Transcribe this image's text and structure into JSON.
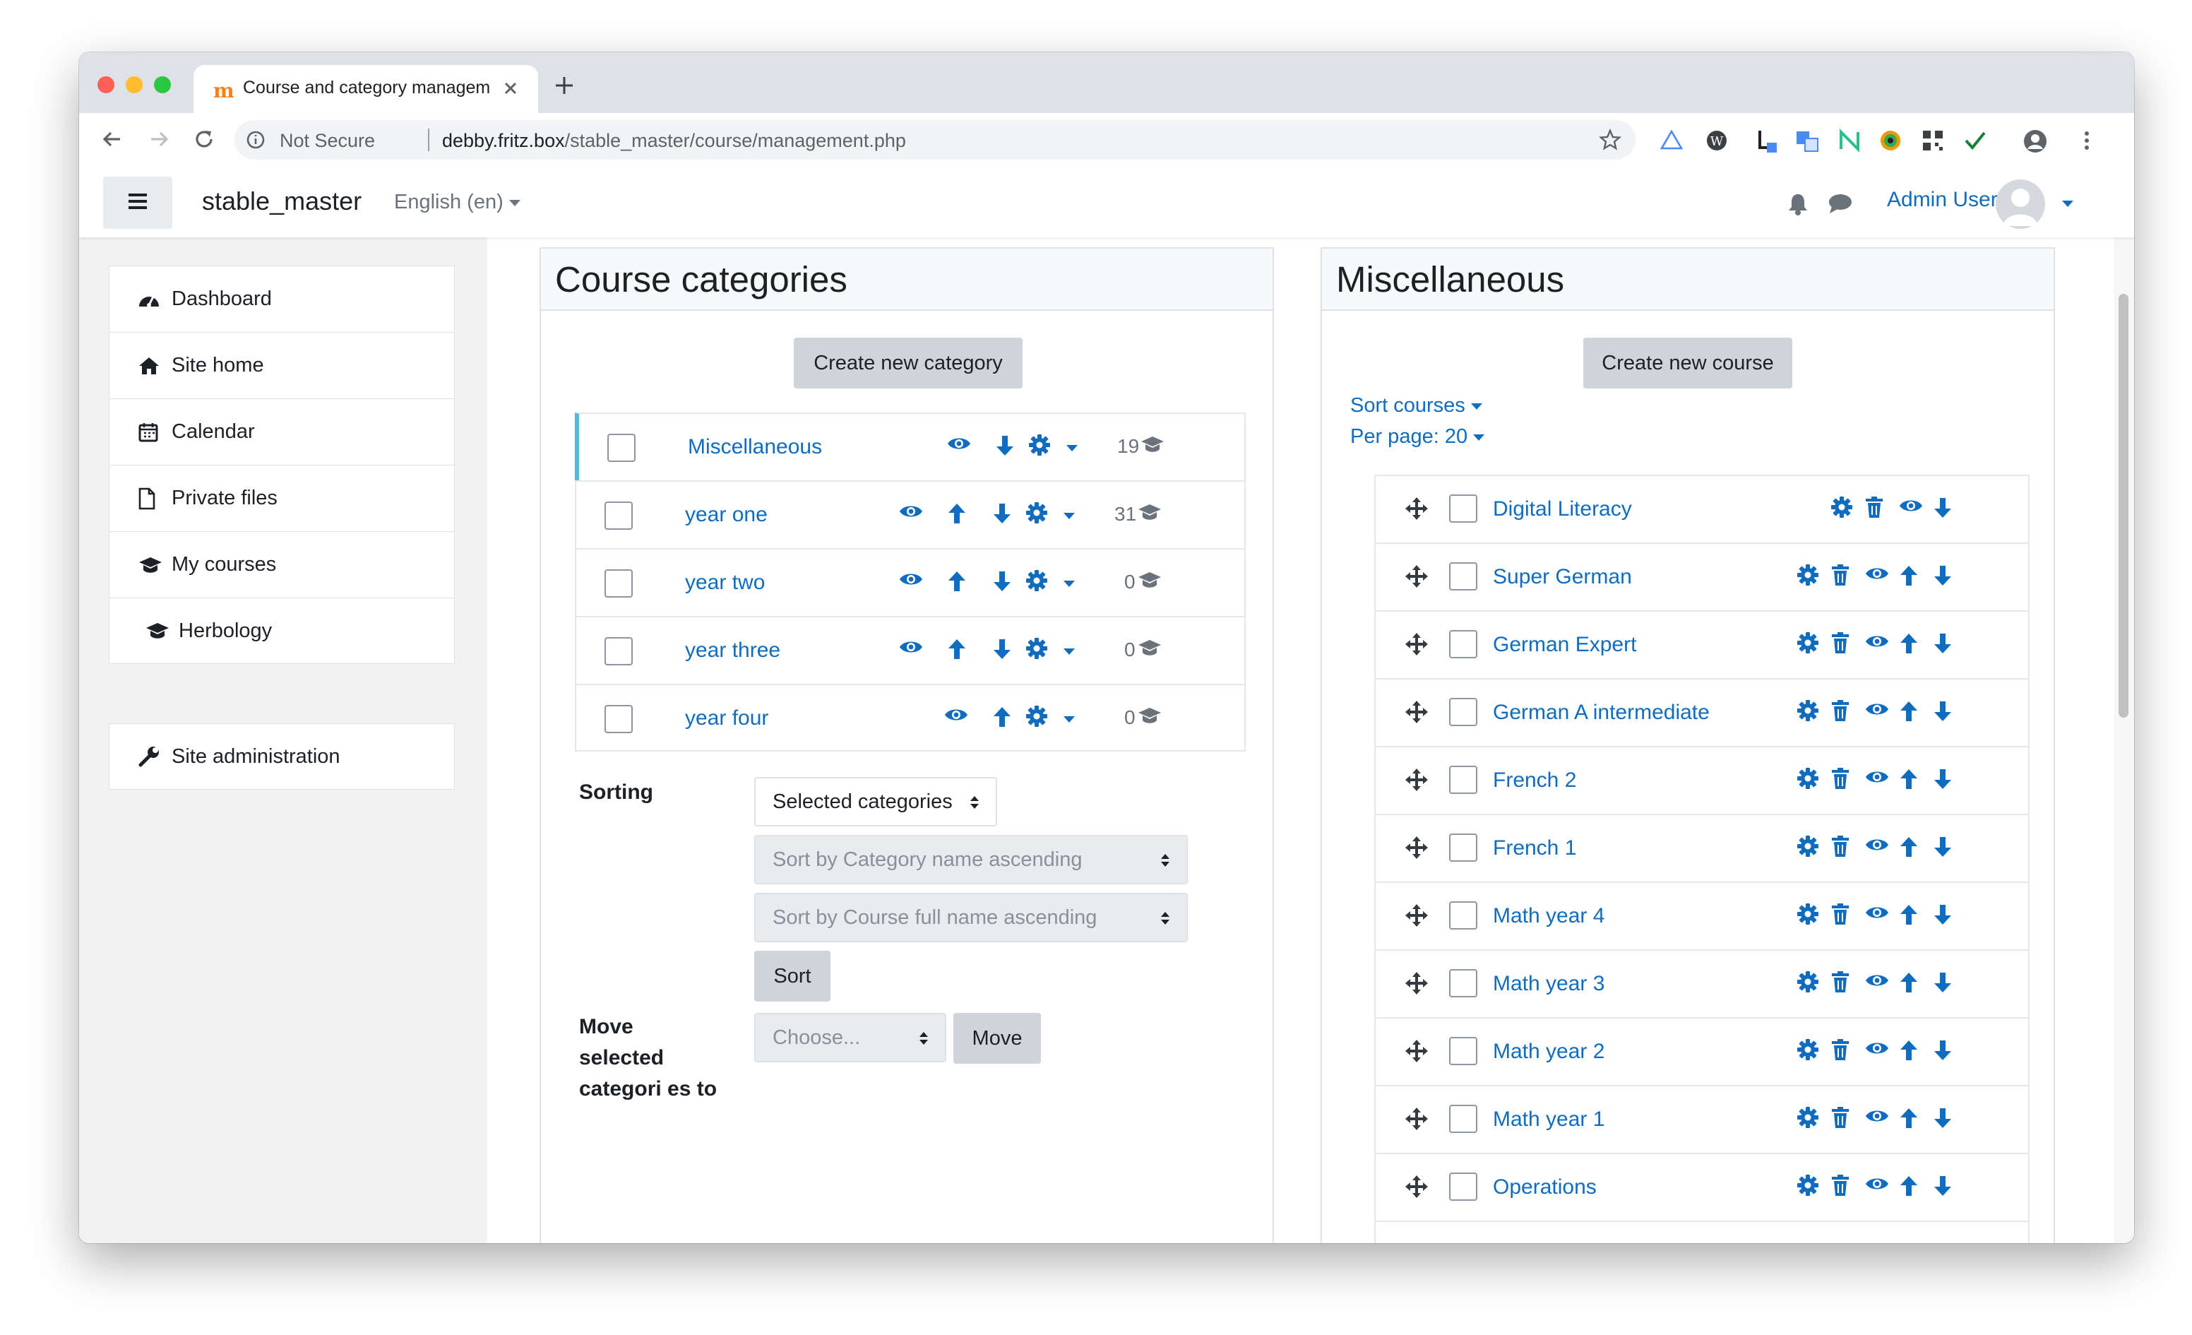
{
  "browser": {
    "tab_title": "Course and category manageme",
    "security": "Not Secure",
    "url_host": "debby.fritz.box",
    "url_path": "/stable_master/course/management.php"
  },
  "navbar": {
    "site_name": "stable_master",
    "language": "English ‎(en)‎",
    "user_name": "Admin User"
  },
  "drawer": {
    "items": [
      {
        "label": "Dashboard",
        "icon": "dashboard-icon"
      },
      {
        "label": "Site home",
        "icon": "home-icon"
      },
      {
        "label": "Calendar",
        "icon": "calendar-icon"
      },
      {
        "label": "Private files",
        "icon": "file-icon"
      },
      {
        "label": "My courses",
        "icon": "graduation-cap-icon"
      },
      {
        "label": "Herbology",
        "icon": "graduation-cap-icon"
      }
    ],
    "admin": {
      "label": "Site administration",
      "icon": "wrench-icon"
    }
  },
  "categories_panel": {
    "heading": "Course categories",
    "create_button": "Create new category",
    "rows": [
      {
        "name": "Miscellaneous",
        "count": "19"
      },
      {
        "name": "year one",
        "count": "31"
      },
      {
        "name": "year two",
        "count": "0"
      },
      {
        "name": "year three",
        "count": "0"
      },
      {
        "name": "year four",
        "count": "0"
      }
    ],
    "sorting_label": "Sorting",
    "sort_scope": "Selected categories",
    "sort_categories": "Sort by Category name ascending",
    "sort_courses": "Sort by Course full name ascending",
    "sort_button": "Sort",
    "move_label": "Move selected categori es to",
    "move_select": "Choose...",
    "move_button": "Move"
  },
  "courses_panel": {
    "heading": "Miscellaneous",
    "create_button": "Create new course",
    "sort_link": "Sort courses",
    "per_page_link": "Per page: 20",
    "courses": [
      "Digital Literacy",
      "Super German",
      "German Expert",
      "German A intermediate",
      "French 2",
      "French 1",
      "Math year 4",
      "Math year 3",
      "Math year 2",
      "Math year 1",
      "Operations"
    ]
  },
  "colors": {
    "link": "#0f6cbf",
    "active_bar": "#5bb6d9",
    "button_grey": "#ced4da",
    "drawer_bg": "#f2f2f2"
  }
}
